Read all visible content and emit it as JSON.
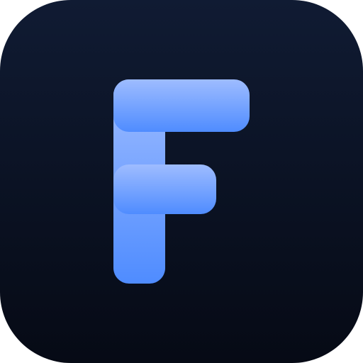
{
  "icon": {
    "name": "app-icon",
    "glyph": "F",
    "background": {
      "top_color": "#101b33",
      "bottom_color": "#060a15"
    },
    "letter": {
      "top_color": "#9ebcff",
      "bottom_color": "#4f8cff"
    }
  }
}
